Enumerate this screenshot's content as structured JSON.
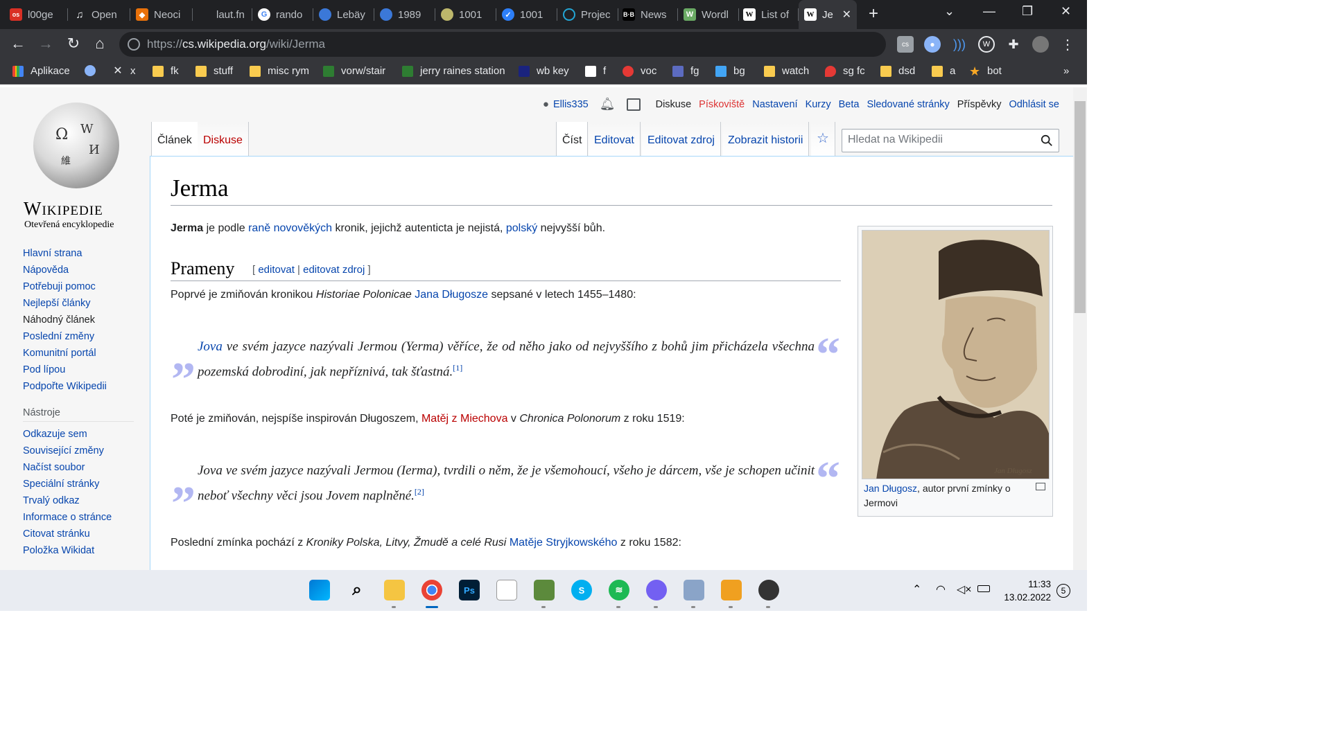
{
  "browser": {
    "tabs": [
      {
        "title": "l00ge",
        "favicon": "os-red"
      },
      {
        "title": "Open",
        "favicon": "headphones"
      },
      {
        "title": "Neoci",
        "favicon": "fox"
      },
      {
        "title": "laut.fn",
        "favicon": "blank"
      },
      {
        "title": "rando",
        "favicon": "google"
      },
      {
        "title": "Lebäy",
        "favicon": "globe"
      },
      {
        "title": "1989",
        "favicon": "globe"
      },
      {
        "title": "1001",
        "favicon": "disc"
      },
      {
        "title": "1001",
        "favicon": "check"
      },
      {
        "title": "Projec",
        "favicon": "circle-blue"
      },
      {
        "title": "News",
        "favicon": "bb"
      },
      {
        "title": "Wordl",
        "favicon": "wordle"
      },
      {
        "title": "List of",
        "favicon": "wikipedia"
      },
      {
        "title": "Je",
        "favicon": "wikipedia",
        "active": true
      }
    ],
    "url_scheme": "https://",
    "url_host": "cs.wikipedia.org",
    "url_path": "/wiki/Jerma",
    "bookmarks": [
      {
        "label": "Aplikace",
        "icon": "apps-grid-icon"
      },
      {
        "label": "",
        "icon": "circle-icon"
      },
      {
        "label": "x",
        "icon": "x-icon"
      },
      {
        "label": "fk",
        "icon": "folder-icon"
      },
      {
        "label": "stuff",
        "icon": "folder-icon"
      },
      {
        "label": "misc rym",
        "icon": "folder-icon"
      },
      {
        "label": "vorw/stair",
        "icon": "vu-icon"
      },
      {
        "label": "jerry raines station",
        "icon": "vu-icon"
      },
      {
        "label": "wb key",
        "icon": "gml-icon"
      },
      {
        "label": "f",
        "icon": "state-icon"
      },
      {
        "label": "voc",
        "icon": "e-icon"
      },
      {
        "label": "fg",
        "icon": "question-icon"
      },
      {
        "label": "bg",
        "icon": "chart-icon"
      },
      {
        "label": "watch",
        "icon": "folder-icon"
      },
      {
        "label": "sg fc",
        "icon": "flame-icon"
      },
      {
        "label": "dsd",
        "icon": "folder-icon"
      },
      {
        "label": "a",
        "icon": "folder-icon"
      },
      {
        "label": "bot",
        "icon": "star-icon"
      }
    ],
    "bookmarks_overflow": "»"
  },
  "wiki": {
    "wordmark": "Wikipedie",
    "tagline": "Otevřená encyklopedie",
    "nav": [
      "Hlavní strana",
      "Nápověda",
      "Potřebuji pomoc",
      "Nejlepší články",
      "Náhodný článek",
      "Poslední změny",
      "Komunitní portál",
      "Pod lípou",
      "Podpořte Wikipedii"
    ],
    "tools_heading": "Nástroje",
    "tools": [
      "Odkazuje sem",
      "Související změny",
      "Načíst soubor",
      "Speciální stránky",
      "Trvalý odkaz",
      "Informace o stránce",
      "Citovat stránku",
      "Položka Wikidat"
    ],
    "user": {
      "name": "Ellis335",
      "links": [
        "Diskuse",
        "Pískoviště",
        "Nastavení",
        "Kurzy",
        "Beta",
        "Sledované stránky",
        "Příspěvky",
        "Odhlásit se"
      ]
    },
    "tabs_left": [
      "Článek",
      "Diskuse"
    ],
    "tabs_right": [
      "Číst",
      "Editovat",
      "Editovat zdroj",
      "Zobrazit historii"
    ],
    "search_placeholder": "Hledat na Wikipedii",
    "title": "Jerma",
    "lead": {
      "bold": "Jerma",
      "t1": " je podle ",
      "l1": "raně novověkých",
      "t2": " kronik, jejichž autenticta je nejistá, ",
      "l2": "polský",
      "t3": " nejvyšší bůh."
    },
    "section_title": "Prameny",
    "edit_links": {
      "open": "[ ",
      "edit": "editovat",
      "sep": " | ",
      "edit_source": "editovat zdroj",
      "close": " ]"
    },
    "p1": {
      "t1": "Poprvé je zmiňován kronikou ",
      "i1": "Historiae Polonicae",
      "t2": " ",
      "l1": "Jana Długosze",
      "t3": " sepsané v letech 1455–1480:"
    },
    "q1": {
      "link": "Jova",
      "text": " ve svém jazyce nazývali Jermou (Yerma) věříce, že od něho jako od nejvyššího z bohů jim přicházela všechna pozemská dobrodiní, jak nepříznivá, tak šťastná.",
      "ref": "[1]"
    },
    "p2": {
      "t1": "Poté je zmiňován, nejspíše inspirován Długoszem, ",
      "l1": "Matěj z Miechova",
      "t2": " v ",
      "i1": "Chronica Polonorum",
      "t3": " z roku 1519:"
    },
    "q2": {
      "text": "Jova ve svém jazyce nazývali Jermou (Ierma), tvrdili o něm, že je všemohoucí, všeho je dárcem, vše je schopen učinit neboť všechny věci jsou Jovem naplněné.",
      "ref": "[2]"
    },
    "p3": {
      "t1": "Poslední zmínka pochází z ",
      "i1": "Kroniky Polska, Litvy, Žmudě a celé Rusi",
      "t2": " ",
      "l1": "Matěje Stryjkowského",
      "t3": " z roku 1582:"
    },
    "caption": {
      "link": "Jan Długosz",
      "text": ", autor první zmínky o Jermovi"
    },
    "portrait_signature": "Jan Długosz"
  },
  "taskbar": {
    "time": "11:33",
    "date": "13.02.2022",
    "notifications": "5"
  },
  "colors": {
    "link": "#0645ad",
    "redlink": "#ba0000",
    "chrome_dark": "#202124",
    "chrome_mid": "#35363a"
  }
}
